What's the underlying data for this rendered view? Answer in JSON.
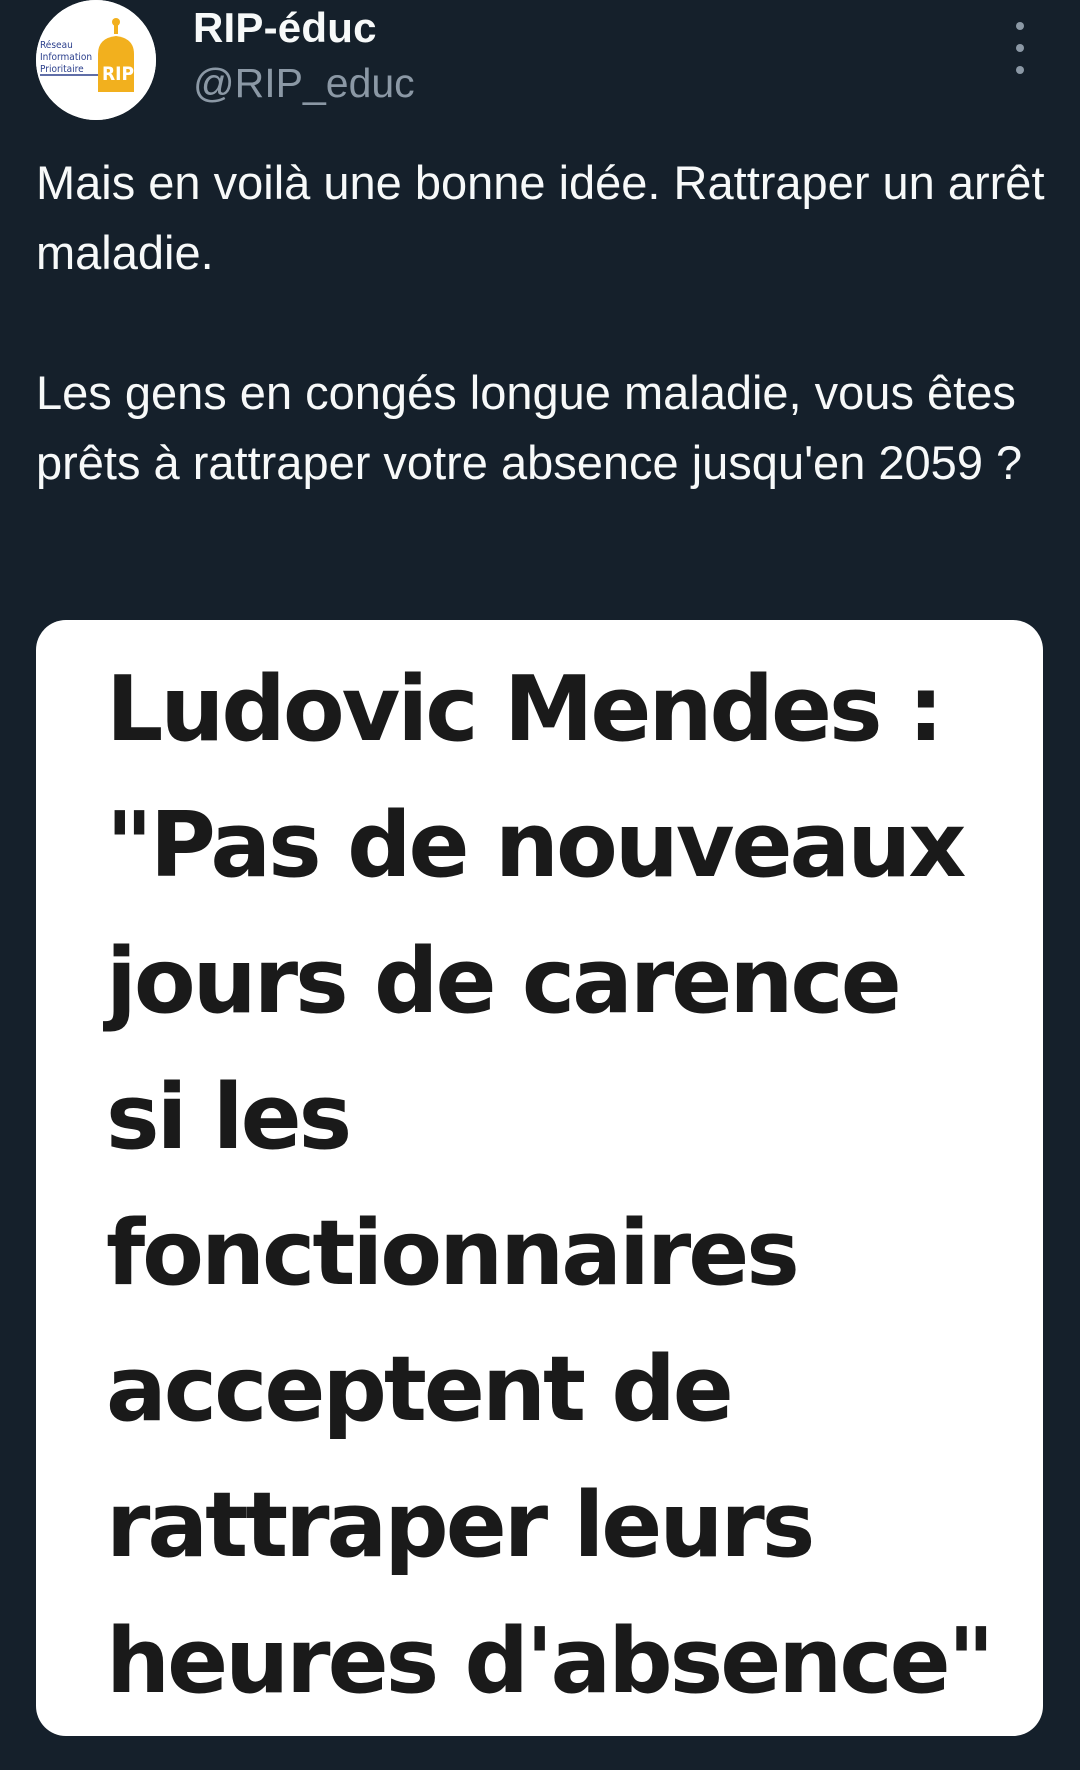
{
  "author": {
    "display_name": "RIP-éduc",
    "handle": "@RIP_educ",
    "avatar_logo": {
      "lines": [
        "Réseau",
        "Information",
        "Prioritaire"
      ],
      "badge": "RIP"
    }
  },
  "tweet": {
    "paragraphs": [
      "Mais en voilà une bonne idée. Rattraper un arrêt maladie.",
      "Les gens en congés longue maladie, vous êtes prêts à rattraper votre absence jusqu'en 2059 ?"
    ]
  },
  "media": {
    "headline_lines": [
      "Ludovic Mendes :",
      "\"Pas de nouveaux",
      "jours de carence",
      "si les",
      "fonctionnaires",
      "acceptent de",
      "rattraper leurs",
      "heures d'absence\""
    ]
  },
  "icons": {
    "more": "more-vertical-icon"
  },
  "colors": {
    "background": "#15202b",
    "text_primary": "#f7f9f9",
    "text_secondary": "#8b98a5",
    "card_background": "#ffffff",
    "card_text": "#1a1a1a"
  }
}
